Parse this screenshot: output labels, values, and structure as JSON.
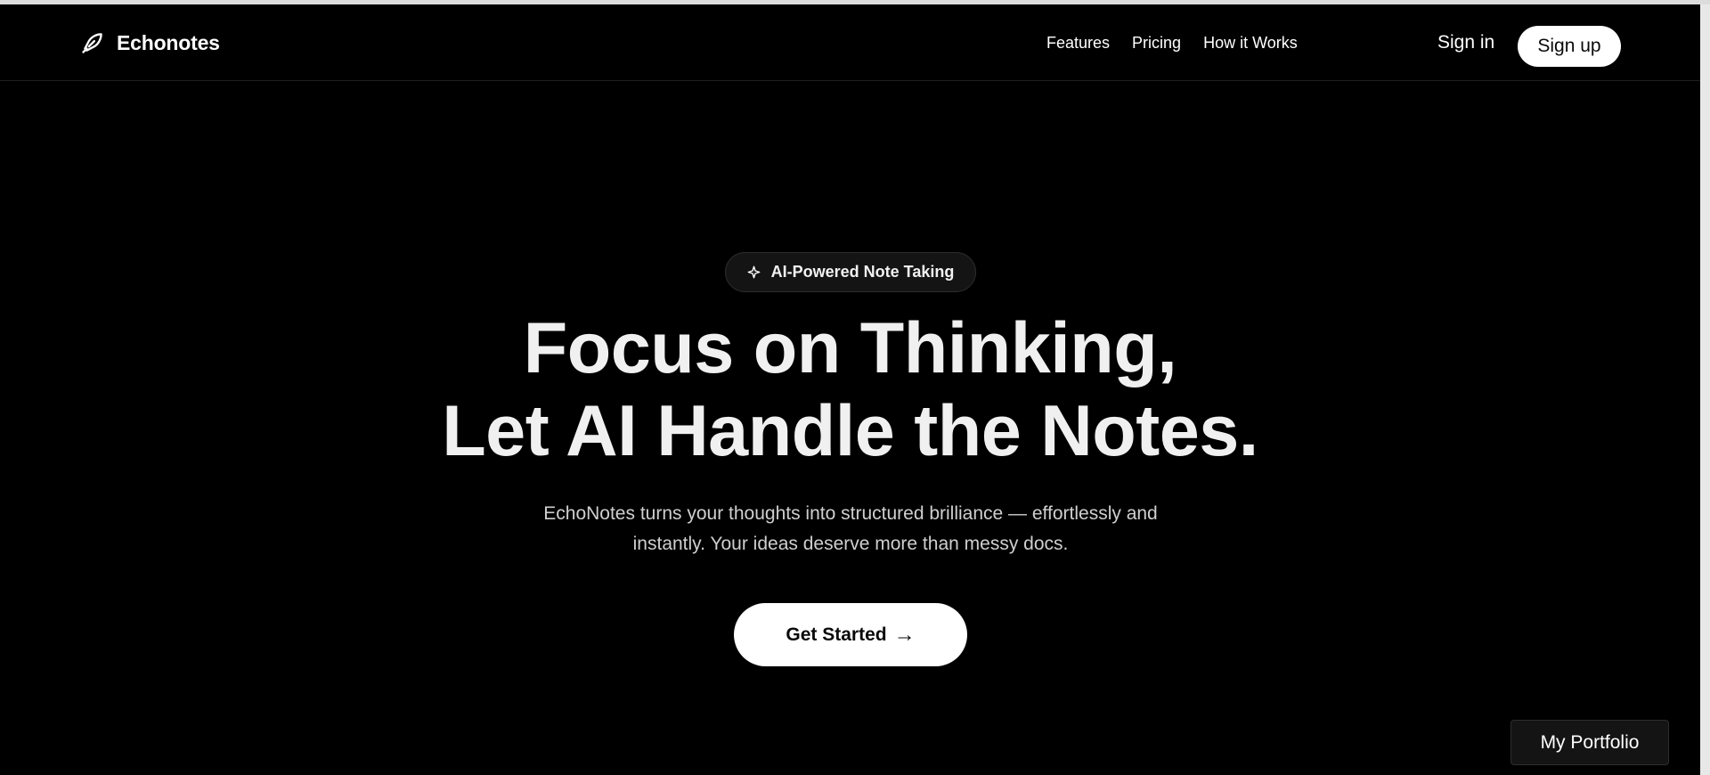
{
  "header": {
    "brand": {
      "name": "Echonotes",
      "icon": "feather-pen-icon"
    },
    "nav": [
      {
        "label": "Features"
      },
      {
        "label": "Pricing"
      },
      {
        "label": "How it Works"
      }
    ],
    "signin_label": "Sign in",
    "signup_label": "Sign up"
  },
  "hero": {
    "badge": {
      "icon": "sparkle-icon",
      "label": "AI-Powered Note Taking"
    },
    "title_line1": "Focus on Thinking,",
    "title_line2": "Let AI Handle the Notes.",
    "subtitle_line1": "EchoNotes turns your thoughts into structured brilliance — effortlessly and",
    "subtitle_line2": "instantly. Your ideas deserve more than messy docs.",
    "cta": {
      "label": "Get Started",
      "arrow": "→"
    }
  },
  "floating": {
    "portfolio_label": "My Portfolio"
  },
  "colors": {
    "background": "#000000",
    "primary_button": "#ffffff",
    "text_heading": "#f0f0f0",
    "text_muted": "#cfcfcf",
    "badge_bg": "#141414"
  }
}
